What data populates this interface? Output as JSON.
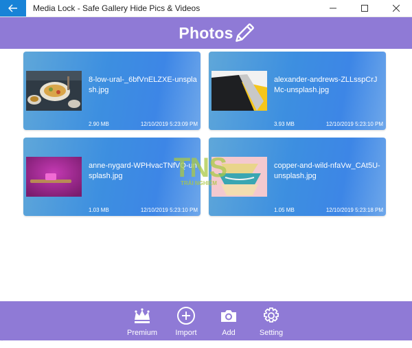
{
  "window": {
    "title": "Media Lock - Safe Gallery Hide Pics & Videos"
  },
  "header": {
    "title": "Photos"
  },
  "photos": [
    {
      "name": "8-low-ural-_6bfVnELZXE-unsplash.jpg",
      "size": "2.90  MB",
      "date": "12/10/2019 5:23:09 PM",
      "thumb": "food-bowl"
    },
    {
      "name": "alexander-andrews-ZLLsspCrJMc-unsplash.jpg",
      "size": "3.93  MB",
      "date": "12/10/2019 5:23:10 PM",
      "thumb": "laptop-yellow"
    },
    {
      "name": "anne-nygard-WPHvacTNfVQ-unsplash.jpg",
      "size": "1.03  MB",
      "date": "12/10/2019 5:23:10 PM",
      "thumb": "toothbrush-magenta"
    },
    {
      "name": "copper-and-wild-nfaVw_CAt5U-unsplash.jpg",
      "size": "1.05  MB",
      "date": "12/10/2019 5:23:18 PM",
      "thumb": "bowls-stack"
    }
  ],
  "watermark": {
    "big": "TNS",
    "small": "TRẢI NGHIỆM"
  },
  "bottom_nav": [
    {
      "label": "Premium",
      "icon": "crown-icon"
    },
    {
      "label": "Import",
      "icon": "plus-circle-icon"
    },
    {
      "label": "Add",
      "icon": "camera-icon"
    },
    {
      "label": "Setting",
      "icon": "gear-icon"
    }
  ],
  "colors": {
    "accent": "#8f7ad6",
    "back_button": "#1883d7"
  }
}
